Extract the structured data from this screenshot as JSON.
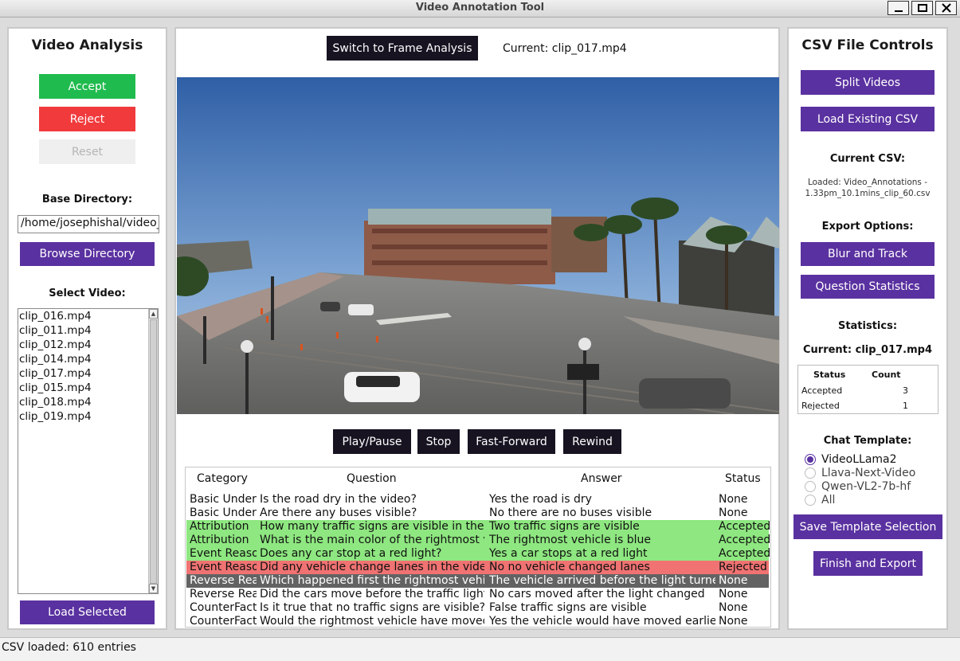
{
  "window": {
    "title": "Video Annotation Tool"
  },
  "left": {
    "title": "Video Analysis",
    "accept_label": "Accept",
    "reject_label": "Reject",
    "reset_label": "Reset",
    "base_dir_label": "Base Directory:",
    "base_dir_value": "/home/josephishal/video_i",
    "browse_label": "Browse Directory",
    "select_video_label": "Select Video:",
    "videos": [
      "clip_016.mp4",
      "clip_011.mp4",
      "clip_012.mp4",
      "clip_014.mp4",
      "clip_017.mp4",
      "clip_015.mp4",
      "clip_018.mp4",
      "clip_019.mp4"
    ],
    "load_label": "Load Selected"
  },
  "center": {
    "switch_label": "Switch to Frame Analysis",
    "current_label": "Current: clip_017.mp4",
    "controls": {
      "play": "Play/Pause",
      "stop": "Stop",
      "ff": "Fast-Forward",
      "rewind": "Rewind"
    },
    "table": {
      "headers": [
        "Category",
        "Question",
        "Answer",
        "Status"
      ],
      "rows": [
        {
          "category": "Basic Under",
          "question": "Is the road dry in the video?",
          "answer": "Yes the road is dry",
          "status": "None",
          "state": "none"
        },
        {
          "category": "Basic Under",
          "question": "Are there any buses visible?",
          "answer": "No there are no buses visible",
          "status": "None",
          "state": "none"
        },
        {
          "category": "Attribution",
          "question": "How many traffic signs are visible in the fra",
          "answer": "Two traffic signs are visible",
          "status": "Accepted",
          "state": "accepted"
        },
        {
          "category": "Attribution",
          "question": "What is the main color of the rightmost vehi",
          "answer": "The rightmost vehicle is blue",
          "status": "Accepted",
          "state": "accepted"
        },
        {
          "category": "Event Reaso",
          "question": "Does any car stop at a red light?",
          "answer": "Yes a car stops at a red light",
          "status": "Accepted",
          "state": "accepted"
        },
        {
          "category": "Event Reaso",
          "question": "Did any vehicle change lanes in the video?",
          "answer": "No no vehicle changed lanes",
          "status": "Rejected",
          "state": "rejected"
        },
        {
          "category": "Reverse Rea",
          "question": "Which happened first the rightmost vehicle",
          "answer": "The vehicle arrived before the light turned",
          "status": "None",
          "state": "selected"
        },
        {
          "category": "Reverse Rea",
          "question": "Did the cars move before the traffic light ch",
          "answer": "No cars moved after the light changed",
          "status": "None",
          "state": "none"
        },
        {
          "category": "CounterFact",
          "question": "Is it true that no traffic signs are visible?",
          "answer": "False traffic signs are visible",
          "status": "None",
          "state": "none"
        },
        {
          "category": "CounterFact",
          "question": "Would the rightmost vehicle have moved e",
          "answer": "Yes the vehicle would have moved earlier",
          "status": "None",
          "state": "none"
        }
      ]
    }
  },
  "right": {
    "title": "CSV File Controls",
    "split_label": "Split Videos",
    "load_csv_label": "Load Existing CSV",
    "current_csv_label": "Current CSV:",
    "current_csv_line1": "Loaded: Video_Annotations -",
    "current_csv_line2": "1.33pm_10.1mins_clip_60.csv",
    "export_label": "Export Options:",
    "blur_label": "Blur and Track",
    "qstats_label": "Question Statistics",
    "stats_label": "Statistics:",
    "stats_current": "Current: clip_017.mp4",
    "stats_headers": [
      "Status",
      "Count"
    ],
    "stats_rows": [
      {
        "status": "Accepted",
        "count": "3"
      },
      {
        "status": "Rejected",
        "count": "1"
      }
    ],
    "chat_template_label": "Chat Template:",
    "templates": [
      {
        "label": "VideoLLama2",
        "selected": true
      },
      {
        "label": "Llava-Next-Video",
        "selected": false
      },
      {
        "label": "Qwen-VL2-7b-hf",
        "selected": false
      },
      {
        "label": "All",
        "selected": false
      }
    ],
    "save_template_label": "Save Template Selection",
    "finish_label": "Finish and Export"
  },
  "status_bar": {
    "text": "CSV loaded: 610 entries"
  },
  "colors": {
    "accent": "#5a31a0",
    "accept": "#20bb4e",
    "reject": "#f13a3c",
    "accepted_row": "#8ee780",
    "rejected_row": "#f07272",
    "selected_row": "#626262"
  }
}
